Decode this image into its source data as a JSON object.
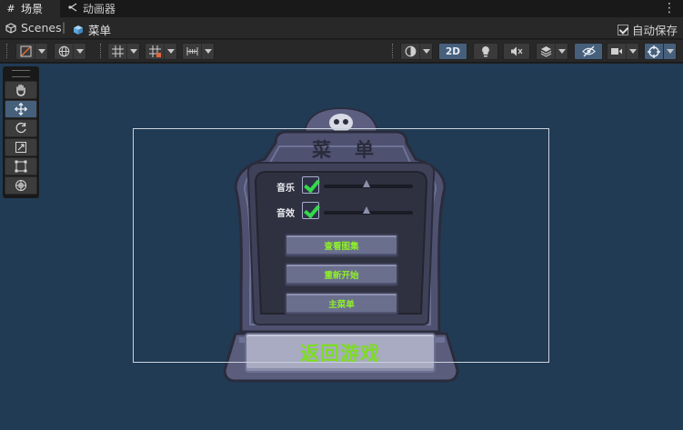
{
  "tabs": [
    {
      "label": "场景",
      "icon": "grid-icon"
    },
    {
      "label": "动画器",
      "icon": "animator-icon"
    }
  ],
  "breadcrumb": {
    "root": "Scenes",
    "current": "菜单"
  },
  "autosave": {
    "label": "自动保存",
    "checked": true
  },
  "toolbar": {
    "mode_2d_label": "2D"
  },
  "tools": [
    "hand-tool",
    "move-tool",
    "rotate-tool",
    "scale-tool",
    "rect-tool",
    "transform-tool"
  ],
  "menu": {
    "title": "菜单",
    "music_label": "音乐",
    "sfx_label": "音效",
    "music_enabled": true,
    "sfx_enabled": true,
    "music_volume": 0.5,
    "sfx_volume": 0.5,
    "buttons": [
      "查看图集",
      "重新开始",
      "主菜单"
    ],
    "resume_label": "返回游戏"
  },
  "colors": {
    "scene_bg": "#213b55",
    "stone": "#4e5170",
    "button_text": "#8ef02a",
    "selected_tool": "#46607c"
  }
}
